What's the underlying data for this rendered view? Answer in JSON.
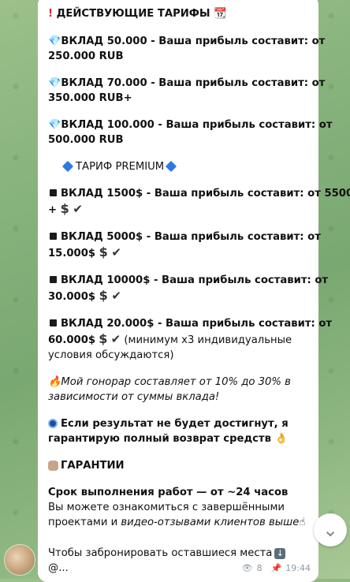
{
  "message": {
    "title": {
      "icon": "!",
      "text": "ДЕЙСТВУЮЩИЕ ТАРИФЫ",
      "icon2": "📆"
    },
    "vklad": [
      {
        "line1": "ВКЛАД 50.000 - Ваша прибыль составит: от",
        "line2": "250.000 RUB"
      },
      {
        "line1": "ВКЛАД 70.000 - Ваша прибыль составит: от",
        "line2": "350.000 RUB+"
      },
      {
        "line1": "ВКЛАД 100.000 - Ваша прибыль составит: от",
        "line2": "500.000 RUB"
      }
    ],
    "premium": "ТАРИФ PREMIUM",
    "premium_items": [
      {
        "line1": "ВКЛАД 1500$ - Ваша прибыль составит: от 5500$",
        "line2": "+"
      },
      {
        "line1": "ВКЛАД 5000$ - Ваша прибыль составит: от",
        "line2": "15.000$"
      },
      {
        "line1": "ВКЛАД 10000$ - Ваша прибыль составит: от",
        "line2": "30.000$"
      },
      {
        "line1": "ВКЛАД 20.000$ - Ваша прибыль составит: от",
        "line2": "60.000$",
        "line2_extra": "(минимум х3 индивидуальные",
        "line3": "условия обсуждаются)"
      }
    ],
    "honorar": {
      "line1": "Мой гонорар составляет от 10% до 30% в",
      "line2": "зависимости от суммы вклада!"
    },
    "guarantee": {
      "line1": "Если результат не будет достигнут, я",
      "line2": "гарантирую полный возврат средств"
    },
    "garantii": "ГАРАНТИИ",
    "srok": {
      "bold": "Срок выполнения работ — от ~24 часов",
      "line2": "Вы можете ознакомиться с завершёнными",
      "line3_plain": "проектами и ",
      "line3_italic": "видео-отзывами клиентов выше"
    },
    "book": {
      "line1": "Чтобы забронировать оставшиеся места",
      "line2": "@..."
    },
    "views": "8",
    "time": "19:44"
  },
  "icons": {
    "dollar": "$",
    "check": "✔",
    "fire": "🔥",
    "eye": "eye-icon",
    "pin": "pin-icon",
    "scroll": "⌄"
  }
}
